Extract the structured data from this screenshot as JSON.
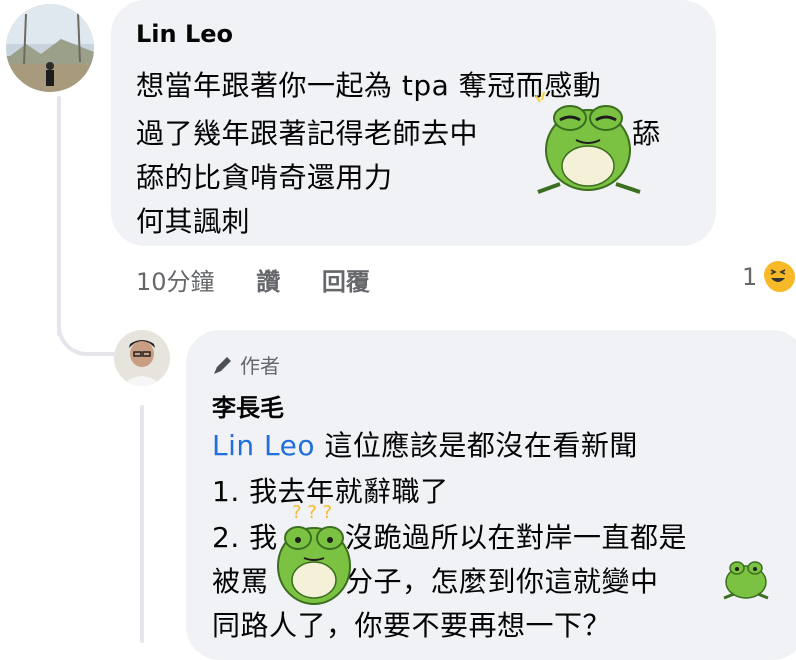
{
  "comment": {
    "author": "Lin Leo",
    "lines": [
      "想當年跟著你一起為 tpa 奪冠而感動",
      "過了幾年跟著記得老師去中",
      "舔",
      "舔的比貪啃奇還用力",
      "何其諷刺"
    ],
    "time": "10分鐘",
    "like": "讚",
    "reply": "回覆",
    "reaction_count": "1"
  },
  "reply": {
    "badge": "作者",
    "author": "李長毛",
    "mention": "Lin Leo",
    "lines": [
      " 這位應該是都沒在看新聞",
      "1. 我去年就辭職了",
      "2. 我",
      "沒跪過所以在對岸一直都是",
      "被罵",
      "分子，怎麼到你這就變中",
      "同路人了，你要不要再想一下？"
    ]
  },
  "colors": {
    "bubble": "#f0f2f5",
    "mention": "#216fdb",
    "frog": "#7cc242",
    "haha": "#f7b928"
  }
}
